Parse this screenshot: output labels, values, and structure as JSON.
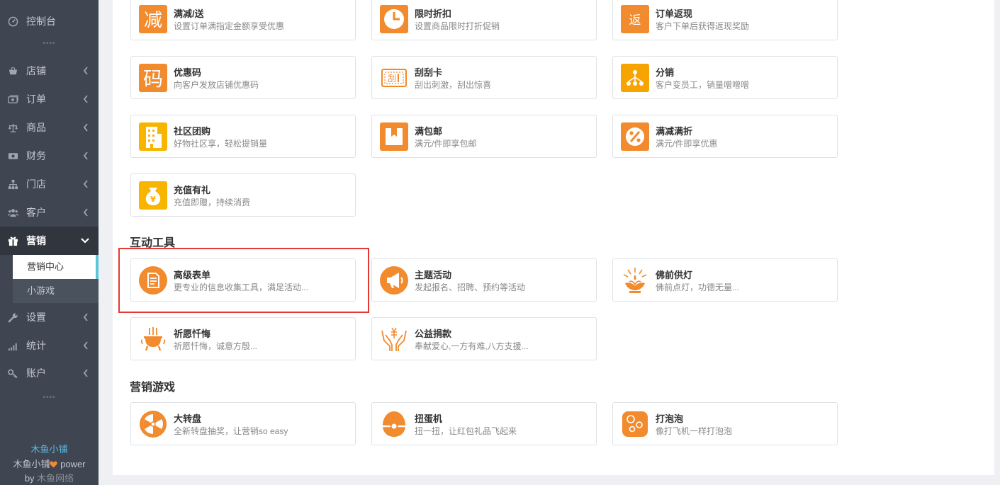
{
  "sidebar": {
    "items": [
      {
        "label": "控制台",
        "icon": "dashboard-icon"
      },
      {
        "label": "店铺",
        "icon": "store-icon"
      },
      {
        "label": "订单",
        "icon": "order-icon"
      },
      {
        "label": "商品",
        "icon": "scale-icon"
      },
      {
        "label": "财务",
        "icon": "money-icon"
      },
      {
        "label": "门店",
        "icon": "sitemap-icon"
      },
      {
        "label": "客户",
        "icon": "users-icon"
      },
      {
        "label": "营销",
        "icon": "gift-icon"
      },
      {
        "label": "设置",
        "icon": "wrench-icon"
      },
      {
        "label": "统计",
        "icon": "signal-icon"
      },
      {
        "label": "账户",
        "icon": "key-icon"
      }
    ],
    "subitems": [
      {
        "label": "营销中心"
      },
      {
        "label": "小游戏"
      }
    ],
    "dots": "••••",
    "footer": {
      "brand": "木鱼小铺",
      "line1_prefix": "木鱼小铺",
      "line1_suffix": " power",
      "line2_prefix": "by ",
      "line2_company": "木鱼网络"
    }
  },
  "sections": {
    "interactive_title": "互动工具",
    "games_title": "营销游戏"
  },
  "cards": {
    "promo": [
      {
        "title": "满减/送",
        "desc": "设置订单满指定金额享受优惠",
        "icon": "discount-char-icon"
      },
      {
        "title": "限时折扣",
        "desc": "设置商品限时打折促销",
        "icon": "clock-icon"
      },
      {
        "title": "订单返现",
        "desc": "客户下单后获得返现奖励",
        "icon": "cashback-char-icon"
      },
      {
        "title": "优惠码",
        "desc": "向客户发放店铺优惠码",
        "icon": "code-char-icon"
      },
      {
        "title": "刮刮卡",
        "desc": "刮出刺激，刮出惊喜",
        "icon": "scratch-card-icon"
      },
      {
        "title": "分销",
        "desc": "客户变员工，销量噌噌噌",
        "icon": "distribution-icon"
      },
      {
        "title": "社区团购",
        "desc": "好物社区享，轻松提销量",
        "icon": "building-icon"
      },
      {
        "title": "满包邮",
        "desc": "满元/件即享包邮",
        "icon": "package-icon"
      },
      {
        "title": "满减满折",
        "desc": "满元/件即享优惠",
        "icon": "percent-icon"
      },
      {
        "title": "充值有礼",
        "desc": "充值即赠，持续消费",
        "icon": "money-bag-icon"
      }
    ],
    "interactive": [
      {
        "title": "高级表单",
        "desc": "更专业的信息收集工具，满足活动...",
        "icon": "form-icon"
      },
      {
        "title": "主题活动",
        "desc": "发起报名、招聘、预约等活动",
        "icon": "megaphone-icon"
      },
      {
        "title": "佛前供灯",
        "desc": "佛前点灯，功德无量...",
        "icon": "lotus-lamp-icon"
      },
      {
        "title": "祈愿忏悔",
        "desc": "祈愿忏悔，诚意方殷...",
        "icon": "incense-burner-icon"
      },
      {
        "title": "公益捐款",
        "desc": "奉献爱心,一方有难,八方支援...",
        "icon": "donation-hands-icon"
      }
    ],
    "games": [
      {
        "title": "大转盘",
        "desc": "全新转盘抽奖，让营销so easy",
        "icon": "wheel-icon"
      },
      {
        "title": "扭蛋机",
        "desc": "扭一扭，让红包礼品飞起来",
        "icon": "gashapon-icon"
      },
      {
        "title": "打泡泡",
        "desc": "像打飞机一样打泡泡",
        "icon": "bubbles-icon"
      }
    ]
  },
  "colors": {
    "accent": "#f28a2e",
    "accent_dark": "#ee7a1a",
    "sidebar_bg": "#3f4652",
    "highlight_border": "#e53935",
    "selected_bar": "#5cc5d8"
  }
}
